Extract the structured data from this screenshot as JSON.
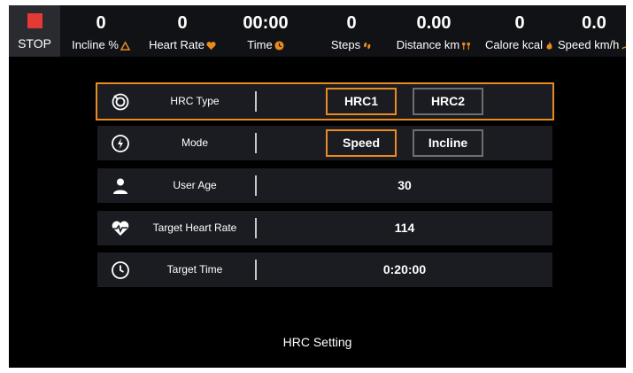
{
  "colors": {
    "accent": "#e98b1f",
    "stop": "#e53935",
    "background": "#000000",
    "panel": "#1b1c22"
  },
  "stop_button": {
    "label": "STOP"
  },
  "metrics": [
    {
      "value": "0",
      "label": "Incline %",
      "icon": "incline-icon"
    },
    {
      "value": "0",
      "label": "Heart Rate",
      "icon": "heart-icon"
    },
    {
      "value": "00:00",
      "label": "Time",
      "icon": "clock-icon"
    },
    {
      "value": "0",
      "label": "Steps",
      "icon": "footsteps-icon"
    },
    {
      "value": "0.00",
      "label": "Distance km",
      "icon": "distance-pin-icon"
    },
    {
      "value": "0",
      "label": "Calore kcal",
      "icon": "flame-icon"
    },
    {
      "value": "0.0",
      "label": "Speed km/h",
      "icon": "speed-icon"
    }
  ],
  "settings": {
    "hrc_type": {
      "label": "HRC Type",
      "options": [
        "HRC1",
        "HRC2"
      ],
      "selected": "HRC1",
      "icon": "hrc-ring-icon"
    },
    "mode": {
      "label": "Mode",
      "options": [
        "Speed",
        "Incline"
      ],
      "selected": "Speed",
      "icon": "lightning-icon"
    },
    "user_age": {
      "label": "User Age",
      "value": "30",
      "icon": "user-icon"
    },
    "target_heart_rate": {
      "label": "Target Heart Rate",
      "value": "114",
      "icon": "heartbeat-icon"
    },
    "target_time": {
      "label": "Target Time",
      "value": "0:20:00",
      "icon": "clock-icon"
    }
  },
  "footer": {
    "title": "HRC Setting"
  }
}
